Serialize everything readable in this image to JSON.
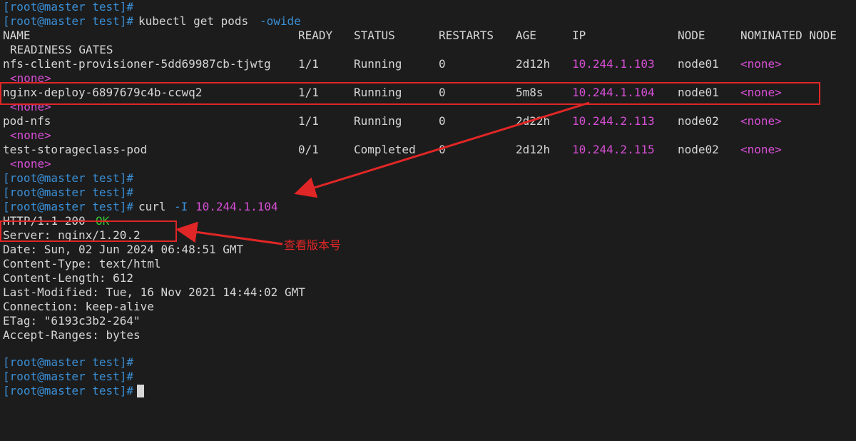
{
  "prompt": "[root@master test]#",
  "command1": {
    "text": "kubectl get pods ",
    "option": "-owide"
  },
  "table": {
    "headers": [
      "NAME",
      "READY",
      "STATUS",
      "RESTARTS",
      "AGE",
      "IP",
      "NODE",
      "NOMINATED NODE",
      "READINESS GATES"
    ],
    "rows": [
      {
        "name": "nfs-client-provisioner-5dd69987cb-tjwtg",
        "ready": "1/1",
        "status": "Running",
        "restarts": "0",
        "age": "2d12h",
        "ip": "10.244.1.103",
        "node": "node01",
        "nominated": "<none>",
        "gates": "<none>"
      },
      {
        "name": "nginx-deploy-6897679c4b-ccwq2",
        "ready": "1/1",
        "status": "Running",
        "restarts": "0",
        "age": "5m8s",
        "ip": "10.244.1.104",
        "node": "node01",
        "nominated": "<none>",
        "gates": "<none>"
      },
      {
        "name": "pod-nfs",
        "ready": "1/1",
        "status": "Running",
        "restarts": "0",
        "age": "2d22h",
        "ip": "10.244.2.113",
        "node": "node02",
        "nominated": "<none>",
        "gates": "<none>"
      },
      {
        "name": "test-storageclass-pod",
        "ready": "0/1",
        "status": "Completed",
        "restarts": "0",
        "age": "2d12h",
        "ip": "10.244.2.115",
        "node": "node02",
        "nominated": "<none>",
        "gates": "<none>"
      }
    ]
  },
  "command2": {
    "text": "curl ",
    "option": "-I",
    "ip": "10.244.1.104"
  },
  "http": {
    "status_prefix": "HTTP/1.1 200 ",
    "status_ok": "OK",
    "headers": [
      "Server: nginx/1.20.2",
      "Date: Sun, 02 Jun 2024 06:48:51 GMT",
      "Content-Type: text/html",
      "Content-Length: 612",
      "Last-Modified: Tue, 16 Nov 2021 14:44:02 GMT",
      "Connection: keep-alive",
      "ETag: \"6193c3b2-264\"",
      "Accept-Ranges: bytes"
    ]
  },
  "annotation": {
    "label": "查看版本号"
  },
  "colors": {
    "prompt": "#3a8fd6",
    "ip": "#d84fd6",
    "ok": "#36c436",
    "annotation": "#e02626",
    "background": "#1c1c1c"
  }
}
